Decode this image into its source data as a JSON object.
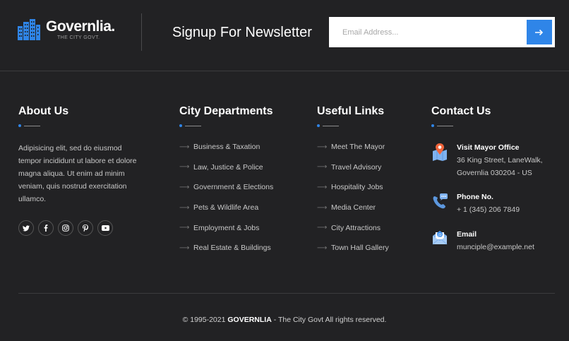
{
  "brand": {
    "name": "Governlia",
    "dot": ".",
    "tagline": "THE CITY GOVT.",
    "accent": "#2f85e8"
  },
  "newsletter": {
    "title": "Signup For Newsletter",
    "placeholder": "Email Address...",
    "submit_icon": "arrow-right-icon"
  },
  "about": {
    "heading": "About Us",
    "text": "Adipisicing elit, sed do eiusmod tempor incididunt ut labore et dolore magna aliqua. Ut enim ad minim veniam, quis nostrud exercitation ullamco.",
    "socials": [
      "twitter-icon",
      "facebook-icon",
      "instagram-icon",
      "pinterest-icon",
      "youtube-icon"
    ]
  },
  "departments": {
    "heading": "City Departments",
    "items": [
      "Business & Taxation",
      "Law, Justice & Police",
      "Government & Elections",
      "Pets & Wildlife Area",
      "Employment & Jobs",
      "Real Estate & Buildings"
    ]
  },
  "useful": {
    "heading": "Useful Links",
    "items": [
      "Meet The Mayor",
      "Travel Advisory",
      "Hospitality Jobs",
      "Media Center",
      "City Attractions",
      "Town Hall Gallery"
    ]
  },
  "contact": {
    "heading": "Contact Us",
    "office": {
      "title": "Visit Mayor Office",
      "line1": "36 King Street, LaneWalk,",
      "line2": "Governlia 030204 - US"
    },
    "phone": {
      "title": "Phone No.",
      "value": "+ 1 (345) 206 7849"
    },
    "email": {
      "title": "Email",
      "value": "munciple@example.net"
    }
  },
  "footer": {
    "prefix": "© 1995-2021",
    "brand": "GOVERNLIA",
    "suffix": "- The City Govt All rights reserved."
  }
}
